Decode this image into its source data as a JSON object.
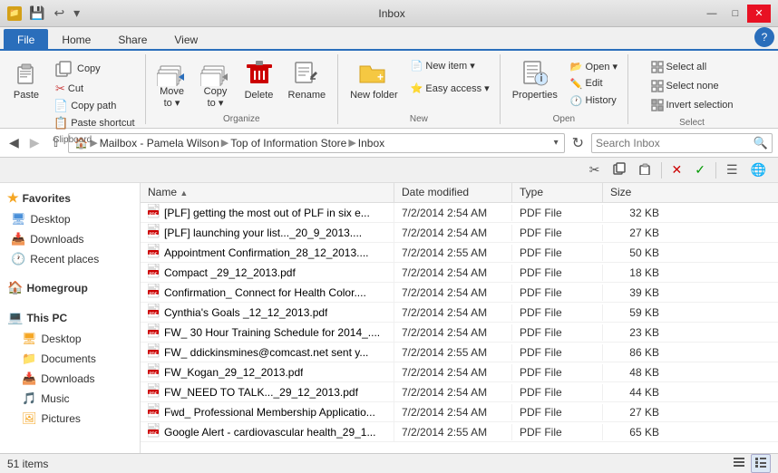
{
  "window": {
    "title": "Inbox",
    "quick_access": [
      "◁",
      "▷",
      "▽"
    ]
  },
  "title_controls": {
    "minimize": "—",
    "maximize": "□",
    "close": "✕"
  },
  "ribbon": {
    "tabs": [
      "File",
      "Home",
      "Share",
      "View"
    ],
    "active_tab": "Home",
    "groups": {
      "clipboard": {
        "label": "Clipboard",
        "copy_label": "Copy",
        "paste_label": "Paste",
        "cut_label": "Cut",
        "copy_path_label": "Copy path",
        "paste_shortcut_label": "Paste shortcut"
      },
      "organize": {
        "label": "Organize",
        "move_to_label": "Move\nto ▾",
        "copy_to_label": "Copy\nto ▾",
        "delete_label": "Delete",
        "rename_label": "Rename"
      },
      "new": {
        "label": "New",
        "new_folder_label": "New\nfolder",
        "new_item_label": "New item ▾",
        "easy_access_label": "Easy access ▾"
      },
      "open": {
        "label": "Open",
        "open_label": "Open ▾",
        "edit_label": "Edit",
        "history_label": "History",
        "properties_label": "Properties"
      },
      "select": {
        "label": "Select",
        "select_all_label": "Select all",
        "select_none_label": "Select none",
        "invert_label": "Invert selection"
      }
    }
  },
  "address_bar": {
    "back_tooltip": "Back",
    "forward_tooltip": "Forward",
    "up_tooltip": "Up",
    "breadcrumb": [
      "Mailbox - Pamela Wilson",
      "Top of Information Store",
      "Inbox"
    ],
    "search_placeholder": "Search Inbox",
    "refresh_tooltip": "Refresh"
  },
  "toolbar": {
    "cut_icon": "✂",
    "copy_icon": "⧉",
    "paste_icon": "📋",
    "delete_icon": "✕",
    "check_icon": "✓",
    "details_icon": "☰",
    "globe_icon": "🌐"
  },
  "left_panel": {
    "favorites": {
      "label": "Favorites",
      "items": [
        "Desktop",
        "Downloads",
        "Recent places"
      ]
    },
    "homegroup": {
      "label": "Homegroup"
    },
    "this_pc": {
      "label": "This PC",
      "items": [
        "Desktop",
        "Documents",
        "Downloads",
        "Music",
        "Pictures"
      ]
    }
  },
  "file_list": {
    "columns": [
      "Name",
      "Date modified",
      "Type",
      "Size"
    ],
    "files": [
      {
        "name": "[PLF] getting the most out of PLF in six e...",
        "date": "7/2/2014 2:54 AM",
        "type": "PDF File",
        "size": "32 KB"
      },
      {
        "name": "[PLF] launching your list..._20_9_2013....",
        "date": "7/2/2014 2:54 AM",
        "type": "PDF File",
        "size": "27 KB"
      },
      {
        "name": "Appointment Confirmation_28_12_2013....",
        "date": "7/2/2014 2:55 AM",
        "type": "PDF File",
        "size": "50 KB"
      },
      {
        "name": "Compact _29_12_2013.pdf",
        "date": "7/2/2014 2:54 AM",
        "type": "PDF File",
        "size": "18 KB"
      },
      {
        "name": "Confirmation_ Connect for Health Color....",
        "date": "7/2/2014 2:54 AM",
        "type": "PDF File",
        "size": "39 KB"
      },
      {
        "name": "Cynthia's Goals _12_12_2013.pdf",
        "date": "7/2/2014 2:54 AM",
        "type": "PDF File",
        "size": "59 KB"
      },
      {
        "name": "FW_ 30 Hour Training Schedule for 2014_....",
        "date": "7/2/2014 2:54 AM",
        "type": "PDF File",
        "size": "23 KB"
      },
      {
        "name": "FW_ ddickinsmines@comcast.net sent y...",
        "date": "7/2/2014 2:55 AM",
        "type": "PDF File",
        "size": "86 KB"
      },
      {
        "name": "FW_Kogan_29_12_2013.pdf",
        "date": "7/2/2014 2:54 AM",
        "type": "PDF File",
        "size": "48 KB"
      },
      {
        "name": "FW_NEED TO TALK..._29_12_2013.pdf",
        "date": "7/2/2014 2:54 AM",
        "type": "PDF File",
        "size": "44 KB"
      },
      {
        "name": "Fwd_ Professional Membership Applicatio...",
        "date": "7/2/2014 2:54 AM",
        "type": "PDF File",
        "size": "27 KB"
      },
      {
        "name": "Google Alert - cardiovascular health_29_1...",
        "date": "7/2/2014 2:55 AM",
        "type": "PDF File",
        "size": "65 KB"
      }
    ]
  },
  "status_bar": {
    "item_count": "51 items"
  }
}
